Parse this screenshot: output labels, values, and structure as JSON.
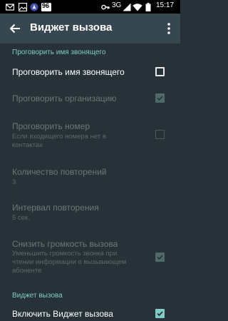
{
  "status_bar": {
    "network_type": "3G",
    "battery_level": "96",
    "time": "15:17",
    "left_icons": [
      "gmail-icon",
      "image-icon",
      "navigation-icon"
    ],
    "right_icons": [
      "key-icon",
      "signal-icon",
      "wifi-icon",
      "battery-icon"
    ]
  },
  "app_bar": {
    "title": "Виджет вызова",
    "back_icon": "arrow-left-icon",
    "menu_icon": "more-vert-icon"
  },
  "sections": [
    {
      "header": "Проговорить имя звонящего",
      "items": [
        {
          "title": "Проговорить имя звонящего",
          "summary": "",
          "checked": false,
          "enabled": true
        },
        {
          "title": "Проговорить организацию",
          "summary": "",
          "checked": true,
          "enabled": false
        },
        {
          "title": "Проговорить номер",
          "summary": "Если входящего номера нет в контактах",
          "checked": false,
          "enabled": false
        },
        {
          "title": "Количество повторений",
          "summary": "3",
          "enabled": false
        },
        {
          "title": "Интервал повторения",
          "summary": "5 сек.",
          "enabled": false
        },
        {
          "title": "Снизить громкость вызова",
          "summary": "Уменьшить громкость звонка при чтении информации о вызывающем абоненте",
          "checked": true,
          "enabled": false
        }
      ]
    },
    {
      "header": "Виджет вызова",
      "items": [
        {
          "title": "Включить Виджет вызова",
          "checked": true,
          "enabled": true
        }
      ]
    }
  ],
  "colors": {
    "background": "#263238",
    "app_bar": "#37474F",
    "accent": "#80CBC4",
    "disabled_text": "#6e777c"
  }
}
